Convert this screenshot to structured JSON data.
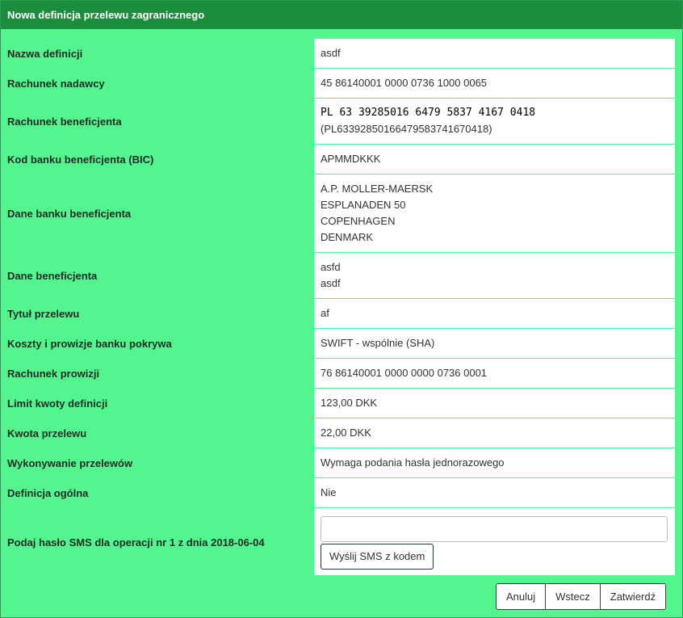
{
  "header": {
    "title": "Nowa definicja przelewu zagranicznego"
  },
  "rows": [
    {
      "label": "Nazwa definicji",
      "lines": [
        "asdf"
      ]
    },
    {
      "label": "Rachunek nadawcy",
      "lines": [
        "45 86140001 0000 0736 1000 0065"
      ]
    },
    {
      "label": "Rachunek beneficjenta",
      "lines": [
        "PL 63 39285016 6479 5837 4167 0418",
        "(PL63392850166479583741670418)"
      ]
    },
    {
      "label": "Kod banku beneficjenta (BIC)",
      "lines": [
        "APMMDKKK"
      ]
    },
    {
      "label": "Dane banku beneficjenta",
      "lines": [
        "A.P. MOLLER-MAERSK",
        "ESPLANADEN 50",
        "COPENHAGEN",
        "DENMARK"
      ]
    },
    {
      "label": "Dane beneficjenta",
      "lines": [
        "asfd",
        "asdf"
      ]
    },
    {
      "label": "Tytuł przelewu",
      "lines": [
        "af"
      ]
    },
    {
      "label": "Koszty i prowizje banku pokrywa",
      "lines": [
        "SWIFT - wspólnie (SHA)"
      ]
    },
    {
      "label": "Rachunek prowizji",
      "lines": [
        "76 86140001 0000 0000 0736 0001"
      ]
    },
    {
      "label": "Limit kwoty definicji",
      "lines": [
        "123,00 DKK"
      ]
    },
    {
      "label": "Kwota przelewu",
      "lines": [
        "22,00 DKK"
      ]
    },
    {
      "label": "Wykonywanie przelewów",
      "lines": [
        "Wymaga podania hasła jednorazowego"
      ]
    },
    {
      "label": "Definicja ogólna",
      "lines": [
        "Nie"
      ]
    }
  ],
  "sms": {
    "label": "Podaj hasło SMS dla operacji nr 1 z dnia 2018-06-04",
    "input_value": "",
    "send_button": "Wyślij SMS z kodem"
  },
  "actions": {
    "cancel": "Anuluj",
    "back": "Wstecz",
    "confirm": "Zatwierdź"
  }
}
